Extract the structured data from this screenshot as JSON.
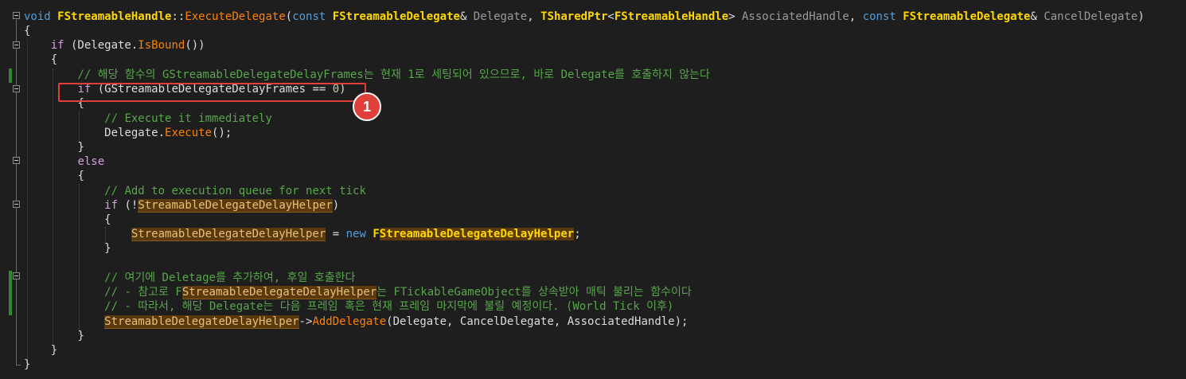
{
  "code": {
    "l1": {
      "kw_void": "void",
      "class_name": "FStreamableHandle",
      "scope": "::",
      "method": "ExecuteDelegate",
      "open": "(",
      "kw_const1": "const",
      "type1": "FStreamableDelegate",
      "amp1": "& ",
      "param1": "Delegate",
      "comma1": ", ",
      "type2": "TSharedPtr",
      "lt": "<",
      "type3": "FStreamableHandle",
      "gt": "> ",
      "param2": "AssociatedHandle",
      "comma2": ", ",
      "kw_const2": "const",
      "type4": "FStreamableDelegate",
      "amp2": "& ",
      "param3": "CancelDelegate",
      "close": ")"
    },
    "l2": "{",
    "l3": {
      "kw_if": "if",
      "pre": " (Delegate.",
      "fn": "IsBound",
      "post": "())"
    },
    "l4": "{",
    "l5": "// 해당 함수의 GStreamableDelegateDelayFrames는 현재 1로 세팅되어 있으므로, 바로 Delegate를 호출하지 않는다",
    "l6": {
      "kw_if": "if",
      "pre": " (GStreamableDelegateDelayFrames == ",
      "num": "0",
      "post": ")"
    },
    "l7": "{",
    "l8": "// Execute it immediately",
    "l9": {
      "pre": "Delegate.",
      "fn": "Execute",
      "post": "();"
    },
    "l10": "}",
    "l11": "else",
    "l12": "{",
    "l13": "// Add to execution queue for next tick",
    "l14": {
      "kw_if": "if",
      "pre": " (!",
      "hl": "StreamableDelegateDelayHelper",
      "post": ")"
    },
    "l15": "{",
    "l16": {
      "hl": "StreamableDelegateDelayHelper",
      "mid": " = ",
      "kw_new": "new",
      "sp": " ",
      "f_prefix": "F",
      "hl_type": "StreamableDelegateDelayHelper",
      "post": ";"
    },
    "l17": "}",
    "l18": "// 여기에 Deletage를 추가하여, 후일 호출한다",
    "l19": {
      "pre": "// - 참고로 F",
      "hl": "StreamableDelegateDelayHelper",
      "post": "는 FTickableGameObject를 상속받아 매틱 불리는 함수이다"
    },
    "l20": "// - 따라서, 해당 Delegate는 다음 프레임 혹은 현재 프레임 마지막에 불릴 예정이다. (World Tick 이후)",
    "l21": {
      "hl": "StreamableDelegateDelayHelper",
      "arrow": "->",
      "fn": "AddDelegate",
      "post": "(Delegate, CancelDelegate, AssociatedHandle);"
    },
    "l22": "}",
    "l23": "}",
    "l24": "}"
  },
  "callout": {
    "number": "1",
    "color": "#e0403a"
  },
  "colors": {
    "background": "#1e1e1e",
    "comment": "#57a64a",
    "keyword": "#569cd6",
    "control_keyword": "#d8a0df",
    "type": "#ffd700",
    "function": "#ff8000",
    "highlight_bg": "#5a3a0c",
    "change_marker": "#2d8a2d"
  }
}
